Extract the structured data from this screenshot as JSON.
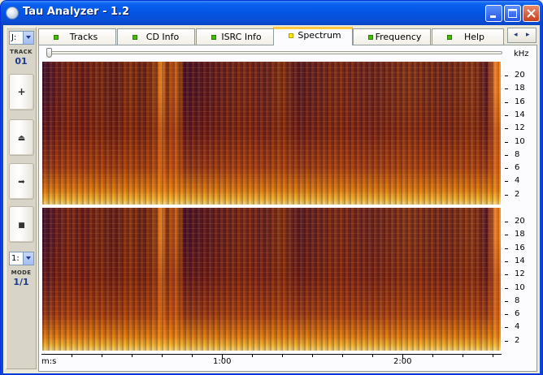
{
  "window": {
    "title": "Tau Analyzer - 1.2",
    "controls": [
      "minimize-icon",
      "maximize-icon",
      "close-icon"
    ]
  },
  "sidebar": {
    "drive_value": "J:",
    "track_caption": "TRACK",
    "track_value": "01",
    "buttons": [
      {
        "name": "add-button",
        "icon": "plus-icon",
        "glyph": "+"
      },
      {
        "name": "eject-button",
        "icon": "eject-icon",
        "glyph": "⏏"
      },
      {
        "name": "play-button",
        "icon": "arrow-right-icon",
        "glyph": "➡"
      },
      {
        "name": "stop-button",
        "icon": "stop-icon",
        "glyph": "■"
      }
    ],
    "mode_select_value": "1:",
    "mode_caption": "MODE",
    "mode_value": "1/1"
  },
  "tabs": [
    {
      "label": "Tracks",
      "active": false
    },
    {
      "label": "CD Info",
      "active": false
    },
    {
      "label": "ISRC Info",
      "active": false
    },
    {
      "label": "Spectrum",
      "active": true
    },
    {
      "label": "Frequency",
      "active": false
    },
    {
      "label": "Help",
      "active": false
    }
  ],
  "tab_scroll": {
    "left": "◂",
    "right": "▸"
  },
  "spectrum": {
    "y_unit": "kHz",
    "y_ticks": [
      "20",
      "18",
      "16",
      "14",
      "12",
      "10",
      "8",
      "6",
      "4",
      "2"
    ],
    "x_unit": "m:s",
    "x_ticks": [
      "1:00",
      "2:00"
    ],
    "channels": 2,
    "colors": {
      "low": "#3a0f33",
      "mid": "#a2461a",
      "high": "#ffd060"
    }
  }
}
